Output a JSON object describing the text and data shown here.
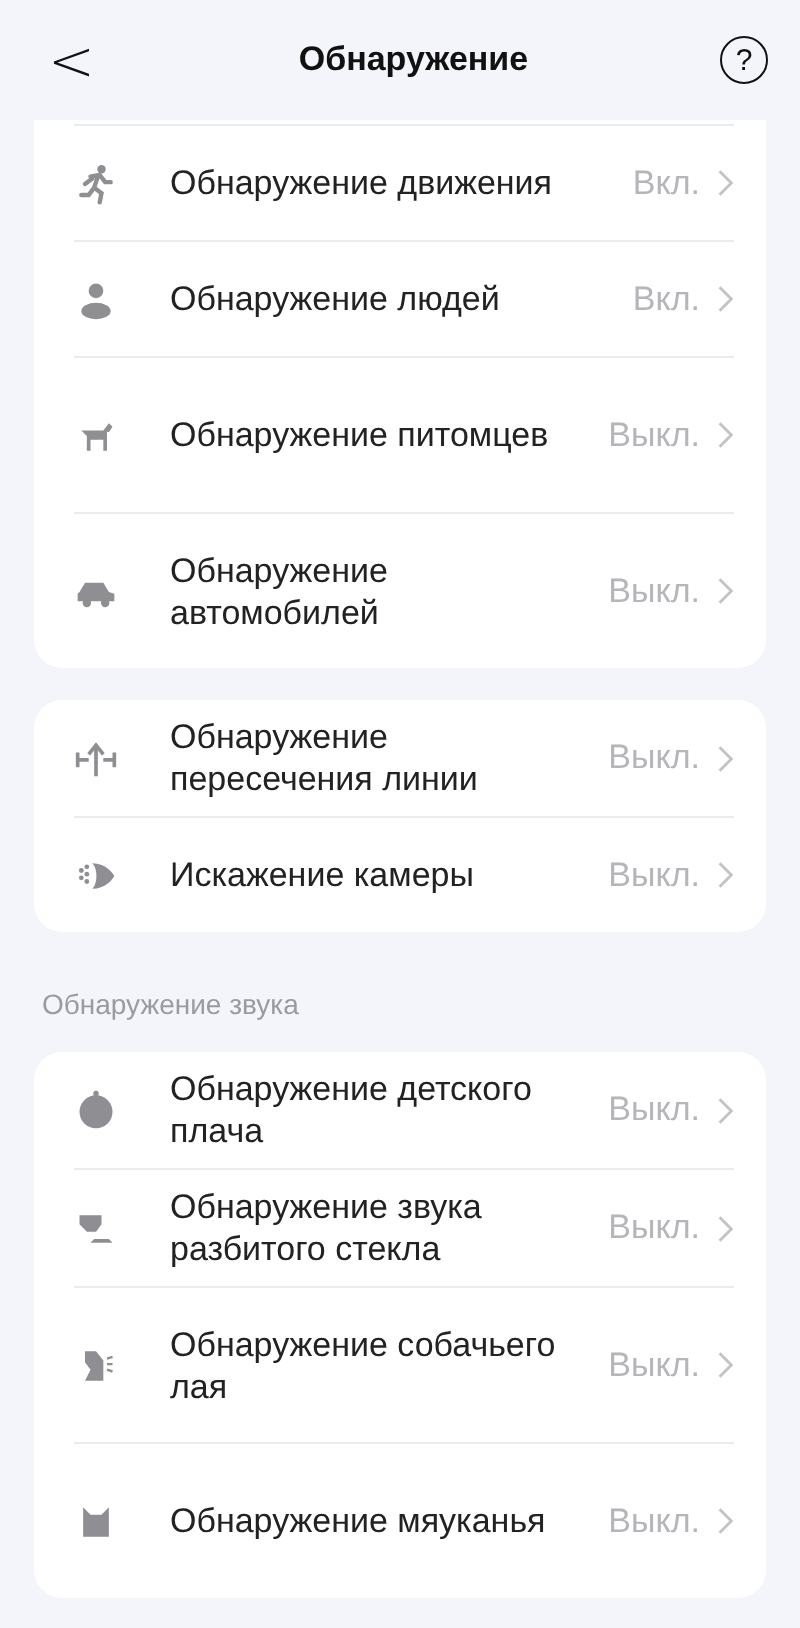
{
  "header": {
    "back": "<",
    "title": "Обнаружение",
    "help": "?"
  },
  "groups": [
    {
      "items": [
        {
          "label": "Обнаружение движения",
          "value": "Вкл."
        },
        {
          "label": "Обнаружение людей",
          "value": "Вкл."
        },
        {
          "label": "Обнаружение питомцев",
          "value": "Выкл."
        },
        {
          "label": "Обнаружение автомобилей",
          "value": "Выкл."
        }
      ]
    },
    {
      "items": [
        {
          "label": "Обнаружение пересечения линии",
          "value": "Выкл."
        },
        {
          "label": "Искажение камеры",
          "value": "Выкл."
        }
      ]
    },
    {
      "title": "Обнаружение звука",
      "items": [
        {
          "label": "Обнаружение детского плача",
          "value": "Выкл."
        },
        {
          "label": "Обнаружение звука разбитого стекла",
          "value": "Выкл."
        },
        {
          "label": "Обнаружение собачьего лая",
          "value": "Выкл."
        },
        {
          "label": "Обнаружение мяуканья",
          "value": "Выкл."
        }
      ]
    }
  ]
}
